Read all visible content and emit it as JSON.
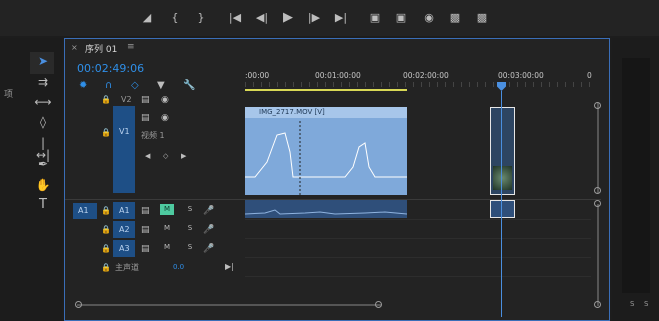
{
  "transport": {
    "icons": [
      "marker-icon",
      "in-point-icon",
      "out-point-icon",
      "go-to-in-icon",
      "step-back-icon",
      "play-icon",
      "step-forward-icon",
      "go-to-out-icon",
      "insert-icon",
      "overwrite-icon",
      "camera-icon",
      "lift-icon",
      "extract-icon"
    ]
  },
  "side_panel": {
    "label": "项"
  },
  "sequence": {
    "close_glyph": "×",
    "tab_title": "序列 01",
    "menu_glyph": "≡",
    "timecode": "00:02:49:06"
  },
  "ruler": {
    "ticks": [
      ":00:00",
      "00:01:00:00",
      "00:02:00:00",
      "00:03:00:00"
    ],
    "tail_tick": "0"
  },
  "tracks": {
    "v2": {
      "label": "V2"
    },
    "v1": {
      "source_label": "V1",
      "label": "V1",
      "name": "视频 1"
    },
    "a1": {
      "source_label": "A1",
      "label": "A1",
      "mute": "M",
      "solo": "S"
    },
    "a2": {
      "label": "A2",
      "mute": "M",
      "solo": "S"
    },
    "a3": {
      "label": "A3",
      "mute": "M",
      "solo": "S"
    },
    "master": {
      "label": "主声道",
      "level": "0.0"
    }
  },
  "clips": {
    "video1": {
      "name": "IMG_2717.MOV [V]"
    }
  },
  "right_panel": {
    "label_a": "S",
    "label_b": "S"
  },
  "colors": {
    "accent": "#3a6eb8",
    "clip_video": "#7fa9da",
    "clip_audio": "#2f4f7a",
    "mute_active": "#4ecaa0",
    "track_active": "#1e4f86"
  }
}
